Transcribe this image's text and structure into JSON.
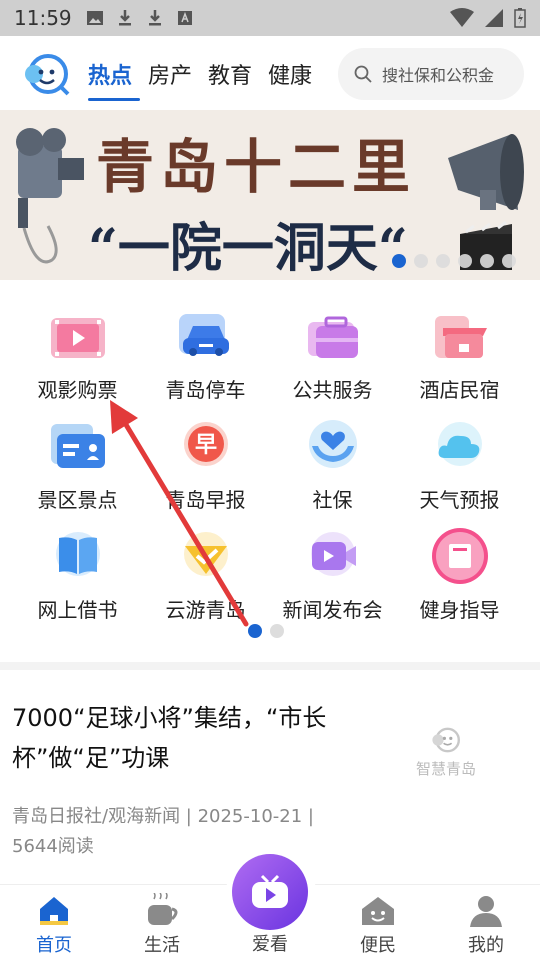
{
  "status_bar": {
    "time": "11:59"
  },
  "header": {
    "tabs": [
      {
        "label": "热点",
        "active": true
      },
      {
        "label": "房产",
        "active": false
      },
      {
        "label": "教育",
        "active": false
      },
      {
        "label": "健康",
        "active": false
      }
    ],
    "search": {
      "placeholder": "搜社保和公积金"
    },
    "accent": "#1a64d0"
  },
  "banner": {
    "title": "青岛十二里",
    "subtitle": "“一院一洞天“",
    "page_count": 6,
    "active_index": 0
  },
  "services": {
    "items": [
      {
        "label": "观影购票",
        "icon": "film-ticket-icon"
      },
      {
        "label": "青岛停车",
        "icon": "car-icon"
      },
      {
        "label": "公共服务",
        "icon": "briefcase-icon"
      },
      {
        "label": "酒店民宿",
        "icon": "hotel-icon"
      },
      {
        "label": "景区景点",
        "icon": "id-card-icon"
      },
      {
        "label": "青岛早报",
        "icon": "newspaper-zao-icon"
      },
      {
        "label": "社保",
        "icon": "heart-hands-icon"
      },
      {
        "label": "天气预报",
        "icon": "cloud-icon"
      },
      {
        "label": "网上借书",
        "icon": "book-icon"
      },
      {
        "label": "云游青岛",
        "icon": "diamond-icon"
      },
      {
        "label": "新闻发布会",
        "icon": "video-camera-icon"
      },
      {
        "label": "健身指导",
        "icon": "fitness-book-icon"
      }
    ],
    "page_count": 2,
    "active_page": 0
  },
  "news": {
    "title": "7000“足球小将”集结，“市长杯”做“足”功课",
    "meta": "青岛日报社/观海新闻 | 2025-10-21 | 5644阅读",
    "thumb_text": "智慧青岛"
  },
  "bottom_nav": {
    "items": [
      {
        "label": "首页",
        "icon": "home-icon",
        "active": true
      },
      {
        "label": "生活",
        "icon": "coffee-cup-icon",
        "active": false
      },
      {
        "label": "爱看",
        "icon": "tv-icon",
        "active": false
      },
      {
        "label": "便民",
        "icon": "house-smile-icon",
        "active": false
      },
      {
        "label": "我的",
        "icon": "user-icon",
        "active": false
      }
    ]
  }
}
